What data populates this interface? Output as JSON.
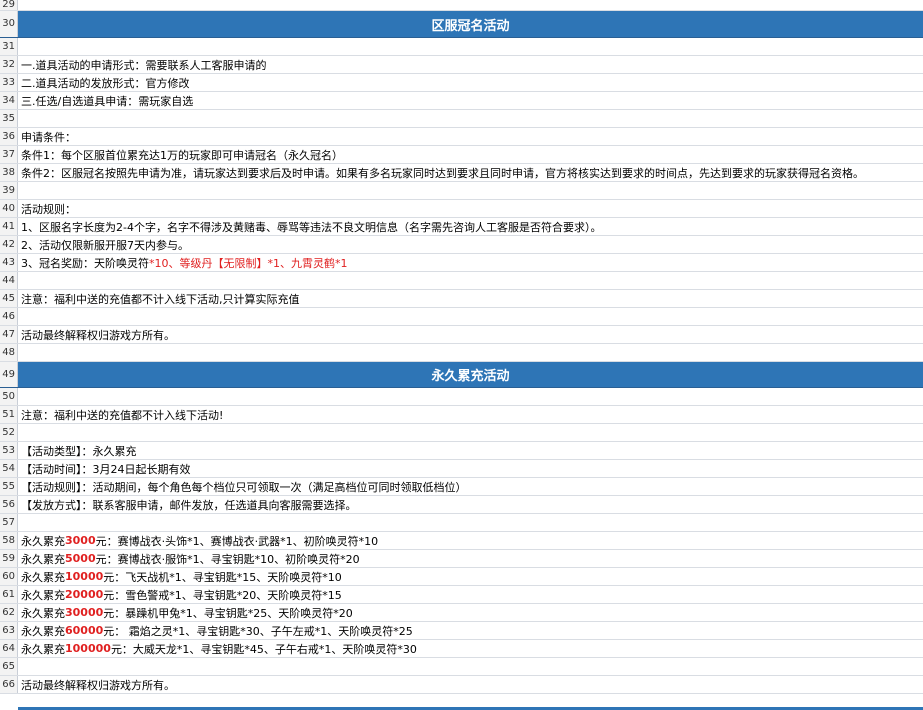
{
  "rows": [
    {
      "n": "29",
      "type": "blank",
      "h": 11
    },
    {
      "n": "30",
      "type": "header",
      "text": "区服冠名活动",
      "h": 27
    },
    {
      "n": "31",
      "type": "blank",
      "h": 18
    },
    {
      "n": "32",
      "type": "text",
      "text": "一.道具活动的申请形式：需要联系人工客服申请的",
      "h": 18
    },
    {
      "n": "33",
      "type": "text",
      "text": "二.道具活动的发放形式：官方修改",
      "h": 18
    },
    {
      "n": "34",
      "type": "text",
      "text": "三.任选/自选道具申请：需玩家自选",
      "h": 18
    },
    {
      "n": "35",
      "type": "blank",
      "h": 18
    },
    {
      "n": "36",
      "type": "text",
      "text": "申请条件：",
      "h": 18
    },
    {
      "n": "37",
      "type": "text",
      "text": "条件1：每个区服首位累充达1万的玩家即可申请冠名（永久冠名）",
      "h": 18
    },
    {
      "n": "38",
      "type": "text",
      "text": "条件2：区服冠名按照先申请为准，请玩家达到要求后及时申请。如果有多名玩家同时达到要求且同时申请，官方将核实达到要求的时间点，先达到要求的玩家获得冠名资格。",
      "h": 18
    },
    {
      "n": "39",
      "type": "blank",
      "h": 18
    },
    {
      "n": "40",
      "type": "text",
      "text": "活动规则：",
      "h": 18
    },
    {
      "n": "41",
      "type": "text",
      "text": "1、区服名字长度为2-4个字，名字不得涉及黄赌毒、辱骂等违法不良文明信息（名字需先咨询人工客服是否符合要求）。",
      "h": 18
    },
    {
      "n": "42",
      "type": "text",
      "text": "2、活动仅限新服开服7天内参与。",
      "h": 18
    },
    {
      "n": "43",
      "type": "mixed",
      "parts": [
        {
          "t": "3、冠名奖励：天阶唤灵符",
          "s": ""
        },
        {
          "t": "*10、等级丹【无限制】*1、九霄灵鹤*1",
          "s": "red"
        }
      ],
      "h": 18
    },
    {
      "n": "44",
      "type": "blank",
      "h": 18
    },
    {
      "n": "45",
      "type": "text",
      "text": "注意：福利中送的充值都不计入线下活动,只计算实际充值",
      "h": 18
    },
    {
      "n": "46",
      "type": "blank",
      "h": 18
    },
    {
      "n": "47",
      "type": "text",
      "text": "活动最终解释权归游戏方所有。",
      "h": 18
    },
    {
      "n": "48",
      "type": "blank",
      "h": 18
    },
    {
      "n": "49",
      "type": "header",
      "text": "永久累充活动",
      "h": 26
    },
    {
      "n": "50",
      "type": "blank",
      "h": 18
    },
    {
      "n": "51",
      "type": "text",
      "text": "注意：福利中送的充值都不计入线下活动!",
      "h": 18
    },
    {
      "n": "52",
      "type": "blank",
      "h": 18
    },
    {
      "n": "53",
      "type": "text",
      "text": "【活动类型】：永久累充",
      "h": 18
    },
    {
      "n": "54",
      "type": "text",
      "text": "【活动时间】：3月24日起长期有效",
      "h": 18
    },
    {
      "n": "55",
      "type": "text",
      "text": "【活动规则】：活动期间，每个角色每个档位只可领取一次（满足高档位可同时领取低档位）",
      "h": 18
    },
    {
      "n": "56",
      "type": "text",
      "text": "【发放方式】：联系客服申请，邮件发放，任选道具向客服需要选择。",
      "h": 18
    },
    {
      "n": "57",
      "type": "blank",
      "h": 18
    },
    {
      "n": "58",
      "type": "mixed",
      "parts": [
        {
          "t": "永久累充",
          "s": ""
        },
        {
          "t": "3000",
          "s": "red bold"
        },
        {
          "t": "元：赛博战衣·头饰*1、赛博战衣·武器*1、初阶唤灵符*10",
          "s": ""
        }
      ],
      "h": 18
    },
    {
      "n": "59",
      "type": "mixed",
      "parts": [
        {
          "t": "永久累充",
          "s": ""
        },
        {
          "t": "5000",
          "s": "red bold"
        },
        {
          "t": "元：赛博战衣·服饰*1、寻宝钥匙*10、初阶唤灵符*20",
          "s": ""
        }
      ],
      "h": 18
    },
    {
      "n": "60",
      "type": "mixed",
      "parts": [
        {
          "t": "永久累充",
          "s": ""
        },
        {
          "t": "10000",
          "s": "red bold"
        },
        {
          "t": "元：飞天战机*1、寻宝钥匙*15、天阶唤灵符*10",
          "s": ""
        }
      ],
      "h": 18
    },
    {
      "n": "61",
      "type": "mixed",
      "parts": [
        {
          "t": "永久累充",
          "s": ""
        },
        {
          "t": "20000",
          "s": "red bold"
        },
        {
          "t": "元：雪色警戒*1、寻宝钥匙*20、天阶唤灵符*15",
          "s": ""
        }
      ],
      "h": 18
    },
    {
      "n": "62",
      "type": "mixed",
      "parts": [
        {
          "t": "永久累充",
          "s": ""
        },
        {
          "t": "30000",
          "s": "red bold"
        },
        {
          "t": "元：暴躁机甲兔*1、寻宝钥匙*25、天阶唤灵符*20",
          "s": ""
        }
      ],
      "h": 18
    },
    {
      "n": "63",
      "type": "mixed",
      "parts": [
        {
          "t": "永久累充",
          "s": ""
        },
        {
          "t": "60000",
          "s": "red bold"
        },
        {
          "t": "元： 霜焰之灵*1、寻宝钥匙*30、子午左戒*1、天阶唤灵符*25",
          "s": ""
        }
      ],
      "h": 18
    },
    {
      "n": "64",
      "type": "mixed",
      "parts": [
        {
          "t": "永久累充",
          "s": ""
        },
        {
          "t": "100000",
          "s": "red bold"
        },
        {
          "t": "元：大威天龙*1、寻宝钥匙*45、子午右戒*1、天阶唤灵符*30",
          "s": ""
        }
      ],
      "h": 18
    },
    {
      "n": "65",
      "type": "blank",
      "h": 18
    },
    {
      "n": "66",
      "type": "text",
      "text": "活动最终解释权归游戏方所有。",
      "h": 18
    }
  ]
}
